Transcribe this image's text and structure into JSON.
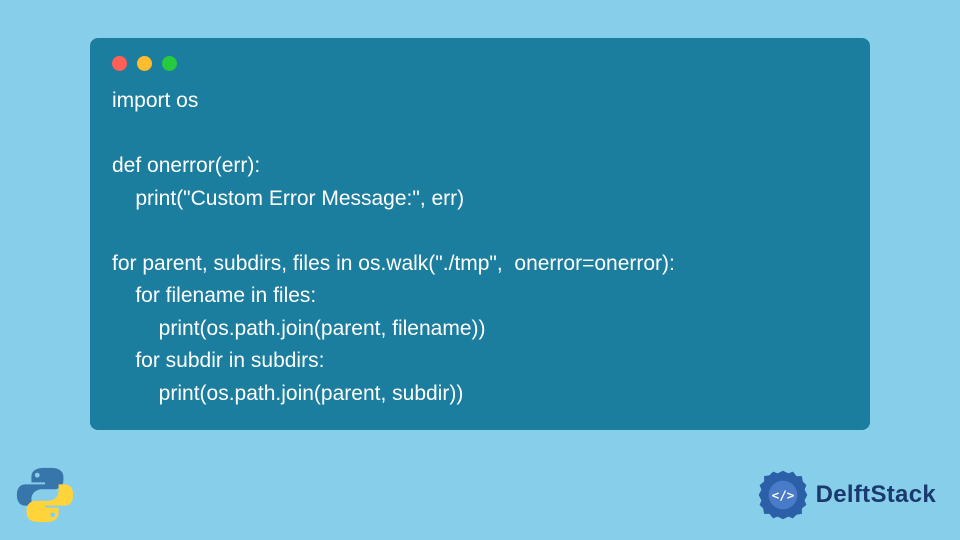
{
  "code": {
    "lines": [
      "import os",
      "",
      "def onerror(err):",
      "    print(\"Custom Error Message:\", err)",
      "",
      "for parent, subdirs, files in os.walk(\"./tmp\",  onerror=onerror):",
      "    for filename in files:",
      "        print(os.path.join(parent, filename))",
      "    for subdir in subdirs:",
      "        print(os.path.join(parent, subdir))"
    ]
  },
  "window": {
    "controls": [
      "red",
      "yellow",
      "green"
    ]
  },
  "branding": {
    "site_name": "DelftStack"
  },
  "colors": {
    "page_bg": "#87CEEB",
    "window_bg": "#1B7E9E",
    "code_text": "#FFFFFF",
    "brand_text": "#1A3A6E"
  }
}
